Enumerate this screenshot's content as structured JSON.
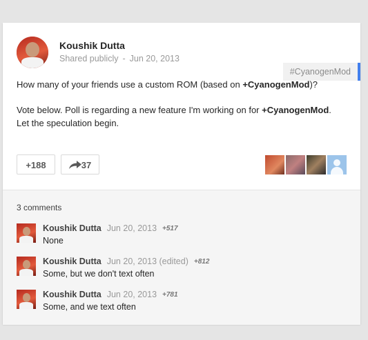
{
  "post": {
    "author": "Koushik Dutta",
    "visibility": "Shared publicly",
    "separator": "-",
    "date": "Jun 20, 2013",
    "hashtag": "#CyanogenMod",
    "line1_pre": "How many of your friends use a custom ROM (based on ",
    "line1_mention": "+CyanogenMod",
    "line1_post": ")?",
    "line2_pre": "Vote below. Poll is regarding a new feature I'm working on for ",
    "line2_mention": "+CyanogenMod",
    "line2_post": ". Let the speculation begin.",
    "plus_count": "+188",
    "share_count": "37"
  },
  "comments": {
    "count_label": "3 comments",
    "items": [
      {
        "author": "Koushik Dutta",
        "date": "Jun 20, 2013",
        "plus": "+517",
        "text": "None"
      },
      {
        "author": "Koushik Dutta",
        "date": "Jun 20, 2013 (edited)",
        "plus": "+812",
        "text": "Some, but we don't text often"
      },
      {
        "author": "Koushik Dutta",
        "date": "Jun 20, 2013",
        "plus": "+781",
        "text": "Some, and we text often"
      }
    ]
  },
  "colors": {
    "accent": "#427fed",
    "page_bg": "#e5e5e5",
    "comments_bg": "#f5f5f5"
  }
}
